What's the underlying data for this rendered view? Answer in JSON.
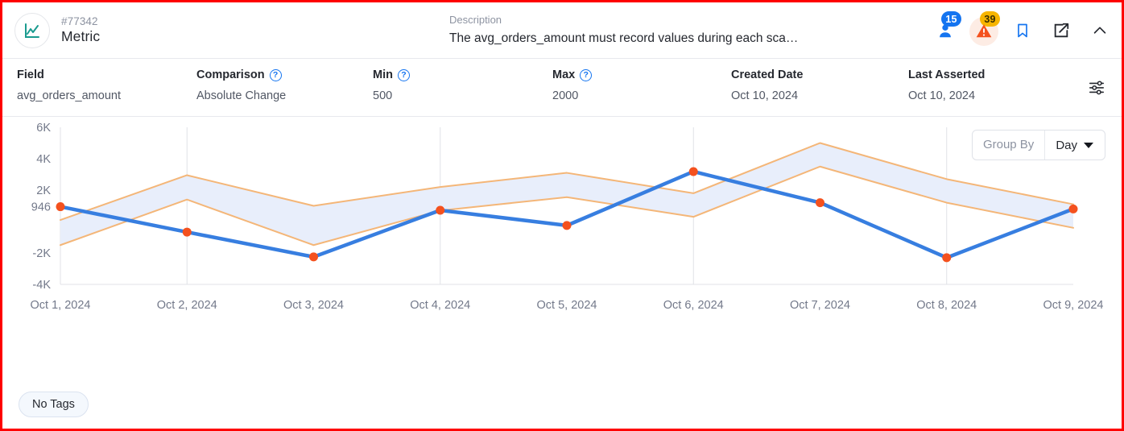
{
  "header": {
    "id_text": "#77342",
    "type_label": "Metric",
    "avatar_icon": "line-chart-icon",
    "description_label": "Description",
    "description_text": "The avg_orders_amount must record values during each sca…",
    "icons": [
      {
        "name": "assignee-icon",
        "badge": "15",
        "badge_color": "#1474f0"
      },
      {
        "name": "alert-warning-icon",
        "badge": "39",
        "badge_color": "#f7b500"
      },
      {
        "name": "bookmark-icon",
        "badge": ""
      },
      {
        "name": "edit-icon",
        "badge": ""
      },
      {
        "name": "chevron-up-icon",
        "badge": ""
      }
    ]
  },
  "meta": {
    "fields": [
      {
        "label": "Field",
        "value": "avg_orders_amount",
        "help": false
      },
      {
        "label": "Comparison",
        "value": "Absolute Change",
        "help": true
      },
      {
        "label": "Min",
        "value": "500",
        "help": true
      },
      {
        "label": "Max",
        "value": "2000",
        "help": true
      },
      {
        "label": "Created Date",
        "value": "Oct 10, 2024",
        "help": false
      },
      {
        "label": "Last Asserted",
        "value": "Oct 10, 2024",
        "help": false
      }
    ],
    "help_glyph": "?",
    "settings_icon": "sliders-icon"
  },
  "controls": {
    "group_by_label": "Group By",
    "group_by_value": "Day",
    "caret_icon": "chevron-down-icon"
  },
  "footer": {
    "tag_label": "No Tags"
  },
  "colors": {
    "line": "#377ee0",
    "point": "#f4511e",
    "band_stroke": "#f4b678",
    "band_fill": "#e8eefb",
    "grid": "#e0e2e7",
    "axis_text": "#73798a"
  },
  "chart_data": {
    "type": "line",
    "title": "",
    "xlabel": "",
    "ylabel": "",
    "grid": true,
    "legend": "none",
    "ylim": [
      -4000,
      6000
    ],
    "yticks": [
      6000,
      4000,
      2000,
      946,
      -2000,
      -4000
    ],
    "ytick_labels": [
      "6K",
      "4K",
      "2K",
      "946",
      "-2K",
      "-4K"
    ],
    "categories": [
      "Oct 1, 2024",
      "Oct 2, 2024",
      "Oct 3, 2024",
      "Oct 4, 2024",
      "Oct 5, 2024",
      "Oct 6, 2024",
      "Oct 7, 2024",
      "Oct 8, 2024",
      "Oct 9, 2024"
    ],
    "series": [
      {
        "name": "value",
        "values": [
          946,
          -670,
          -2250,
          720,
          -250,
          3180,
          1200,
          -2300,
          800
        ]
      },
      {
        "name": "upper_bound",
        "values": [
          100,
          2950,
          1000,
          2200,
          3100,
          1800,
          5000,
          2700,
          1100
        ]
      },
      {
        "name": "lower_bound",
        "values": [
          -1500,
          1400,
          -1500,
          700,
          1550,
          300,
          3500,
          1200,
          -400
        ]
      }
    ]
  }
}
